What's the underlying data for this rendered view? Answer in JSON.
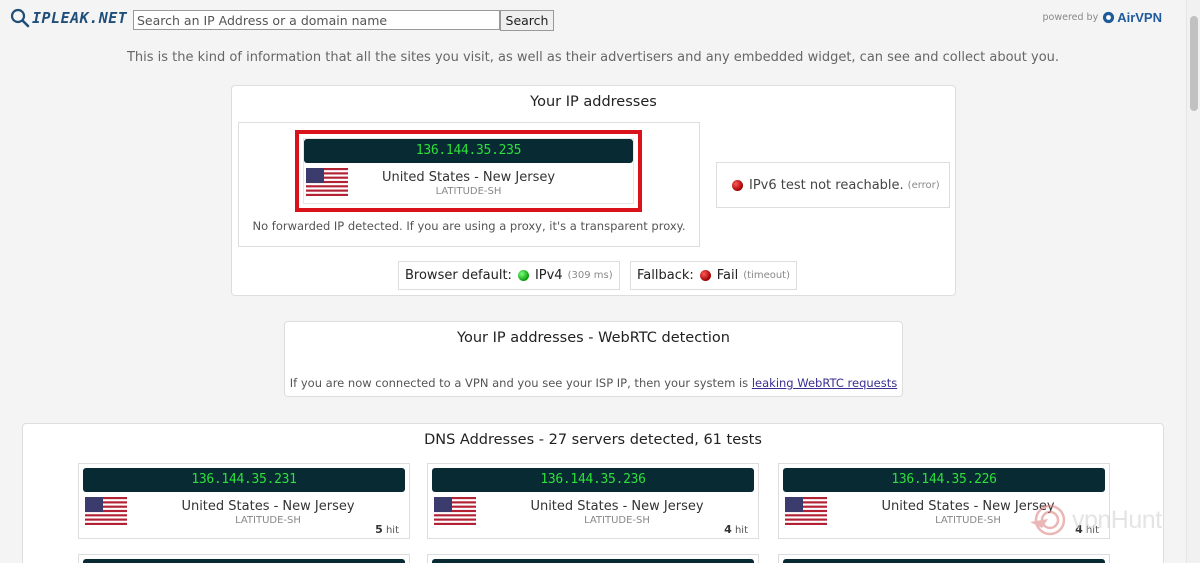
{
  "header": {
    "logo_text": "IPLEAK.NET",
    "search_placeholder": "Search an IP Address or a domain name",
    "search_button": "Search",
    "powered_by": "powered by",
    "airvpn": "AirVPN"
  },
  "intro": "This is the kind of information that all the sites you visit, as well as their advertisers and any embedded widget, can see and collect about you.",
  "ip_panel": {
    "title": "Your IP addresses",
    "ipv4": {
      "ip": "136.144.35.235",
      "location": "United States - New Jersey",
      "isp": "LATITUDE-SH",
      "flag": "us-flag"
    },
    "forward_note": "No forwarded IP detected. If you are using a proxy, it's a transparent proxy.",
    "ipv6": {
      "status_color": "#c00000",
      "text": "IPv6 test not reachable.",
      "detail": "(error)"
    },
    "browser_default": {
      "label": "Browser default:",
      "status_color": "#0a9a0a",
      "value": "IPv4",
      "detail": "(309 ms)"
    },
    "fallback": {
      "label": "Fallback:",
      "status_color": "#c00000",
      "value": "Fail",
      "detail": "(timeout)"
    },
    "highlight_color": "#d9121c"
  },
  "webrtc": {
    "title": "Your IP addresses - WebRTC detection",
    "note": "If you are now connected to a VPN and you see your ISP IP, then your system is",
    "link": "leaking WebRTC requests"
  },
  "dns": {
    "title": "DNS Addresses - 27 servers detected, 61 tests",
    "servers": [
      {
        "ip": "136.144.35.231",
        "location": "United States - New Jersey",
        "isp": "LATITUDE-SH",
        "hits": "5",
        "hit_label": "hit"
      },
      {
        "ip": "136.144.35.236",
        "location": "United States - New Jersey",
        "isp": "LATITUDE-SH",
        "hits": "4",
        "hit_label": "hit"
      },
      {
        "ip": "136.144.35.226",
        "location": "United States - New Jersey",
        "isp": "LATITUDE-SH",
        "hits": "4",
        "hit_label": "hit"
      }
    ]
  },
  "watermark": "vpnHunt",
  "colors": {
    "ip_bar_bg": "#082a32",
    "ip_text": "#2edf3b",
    "link": "#3a2e92"
  }
}
